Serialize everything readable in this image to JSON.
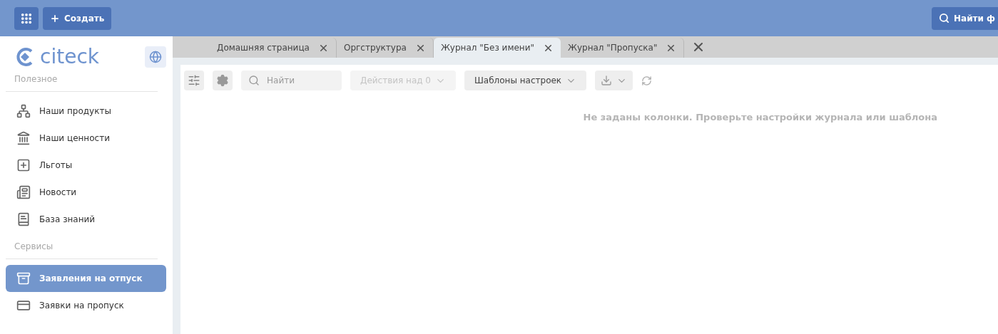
{
  "header": {
    "create_label": "Создать",
    "search_label": "Найти ф"
  },
  "logo": {
    "text": "citeck"
  },
  "sidebar": {
    "sections": [
      {
        "title": "Полезное",
        "items": [
          {
            "label": "Наши продукты",
            "selected": false
          },
          {
            "label": "Наши ценности",
            "selected": false
          },
          {
            "label": "Льготы",
            "selected": false
          },
          {
            "label": "Новости",
            "selected": false
          },
          {
            "label": "База знаний",
            "selected": false
          }
        ]
      },
      {
        "title": "Сервисы",
        "items": [
          {
            "label": "Заявления на отпуск",
            "selected": true
          },
          {
            "label": "Заявки на пропуск",
            "selected": false
          }
        ]
      }
    ]
  },
  "tabs": [
    {
      "label": "Домашняя страница",
      "selected": false
    },
    {
      "label": "Оргструктура",
      "selected": false
    },
    {
      "label": "Журнал \"Без имени\"",
      "selected": true
    },
    {
      "label": "Журнал \"Пропуска\"",
      "selected": false
    }
  ],
  "toolbar": {
    "search_placeholder": "Найти",
    "actions_label": "Действия над 0",
    "actions_disabled": true,
    "templates_label": "Шаблоны настроек"
  },
  "empty_message": "Не заданы колонки. Проверьте настройки журнала или шаблона"
}
